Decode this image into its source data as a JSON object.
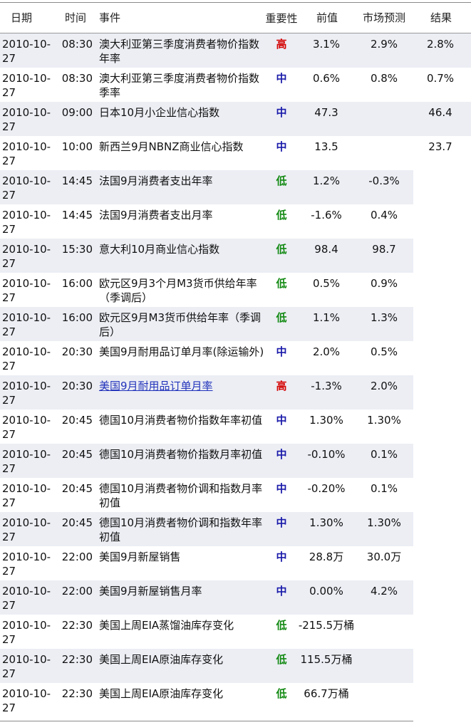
{
  "headers": {
    "date": "日期",
    "time": "时间",
    "event": "事件",
    "importance": "重要性",
    "previous": "前值",
    "forecast": "市场预测",
    "result": "结果"
  },
  "importance_colors": {
    "高": "#d40000",
    "中": "#1a1aaa",
    "低": "#138a13"
  },
  "shade_color": "#eceef4",
  "rows": [
    {
      "date": "2010-10-27",
      "time": "08:30",
      "event": "澳大利亚第三季度消费者物价指数年率",
      "importance": "高",
      "previous": "3.1%",
      "forecast": "2.9%",
      "result": "2.8%",
      "link": false
    },
    {
      "date": "2010-10-27",
      "time": "08:30",
      "event": "澳大利亚第三季度消费者物价指数季率",
      "importance": "中",
      "previous": "0.6%",
      "forecast": "0.8%",
      "result": "0.7%",
      "link": false
    },
    {
      "date": "2010-10-27",
      "time": "09:00",
      "event": "日本10月小企业信心指数",
      "importance": "中",
      "previous": "47.3",
      "forecast": "",
      "result": "46.4",
      "link": false
    },
    {
      "date": "2010-10-27",
      "time": "10:00",
      "event": "新西兰9月NBNZ商业信心指数",
      "importance": "中",
      "previous": "13.5",
      "forecast": "",
      "result": "23.7",
      "link": false
    },
    {
      "date": "2010-10-27",
      "time": "14:45",
      "event": "法国9月消费者支出年率",
      "importance": "低",
      "previous": "1.2%",
      "forecast": "-0.3%",
      "result": "",
      "link": false
    },
    {
      "date": "2010-10-27",
      "time": "14:45",
      "event": "法国9月消费者支出月率",
      "importance": "低",
      "previous": "-1.6%",
      "forecast": "0.4%",
      "result": "",
      "link": false
    },
    {
      "date": "2010-10-27",
      "time": "15:30",
      "event": "意大利10月商业信心指数",
      "importance": "低",
      "previous": "98.4",
      "forecast": "98.7",
      "result": "",
      "link": false
    },
    {
      "date": "2010-10-27",
      "time": "16:00",
      "event": "欧元区9月3个月M3货币供给年率（季调后）",
      "importance": "低",
      "previous": "0.5%",
      "forecast": "0.9%",
      "result": "",
      "link": false
    },
    {
      "date": "2010-10-27",
      "time": "16:00",
      "event": "欧元区9月M3货币供给年率（季调后）",
      "importance": "低",
      "previous": "1.1%",
      "forecast": "1.3%",
      "result": "",
      "link": false
    },
    {
      "date": "2010-10-27",
      "time": "20:30",
      "event": "美国9月耐用品订单月率(除运输外)",
      "importance": "中",
      "previous": "2.0%",
      "forecast": "0.5%",
      "result": "",
      "link": false
    },
    {
      "date": "2010-10-27",
      "time": "20:30",
      "event": "美国9月耐用品订单月率",
      "importance": "高",
      "previous": "-1.3%",
      "forecast": "2.0%",
      "result": "",
      "link": true
    },
    {
      "date": "2010-10-27",
      "time": "20:45",
      "event": "德国10月消费者物价指数年率初值",
      "importance": "中",
      "previous": "1.30%",
      "forecast": "1.30%",
      "result": "",
      "link": false
    },
    {
      "date": "2010-10-27",
      "time": "20:45",
      "event": "德国10月消费者物价指数月率初值",
      "importance": "中",
      "previous": "-0.10%",
      "forecast": "0.1%",
      "result": "",
      "link": false
    },
    {
      "date": "2010-10-27",
      "time": "20:45",
      "event": "德国10月消费者物价调和指数月率初值",
      "importance": "中",
      "previous": "-0.20%",
      "forecast": "0.1%",
      "result": "",
      "link": false
    },
    {
      "date": "2010-10-27",
      "time": "20:45",
      "event": "德国10月消费者物价调和指数年率初值",
      "importance": "中",
      "previous": "1.30%",
      "forecast": "1.30%",
      "result": "",
      "link": false
    },
    {
      "date": "2010-10-27",
      "time": "22:00",
      "event": "美国9月新屋销售",
      "importance": "中",
      "previous": "28.8万",
      "forecast": "30.0万",
      "result": "",
      "link": false
    },
    {
      "date": "2010-10-27",
      "time": "22:00",
      "event": "美国9月新屋销售月率",
      "importance": "中",
      "previous": "0.00%",
      "forecast": "4.2%",
      "result": "",
      "link": false
    },
    {
      "date": "2010-10-27",
      "time": "22:30",
      "event": "美国上周EIA蒸馏油库存变化",
      "importance": "低",
      "previous": "-215.5万桶",
      "forecast": "",
      "result": "",
      "link": false
    },
    {
      "date": "2010-10-27",
      "time": "22:30",
      "event": "美国上周EIA原油库存变化",
      "importance": "低",
      "previous": "115.5万桶",
      "forecast": "",
      "result": "",
      "link": false
    },
    {
      "date": "2010-10-27",
      "time": "22:30",
      "event": "美国上周EIA原油库存变化",
      "importance": "低",
      "previous": "66.7万桶",
      "forecast": "",
      "result": "",
      "link": false
    }
  ]
}
